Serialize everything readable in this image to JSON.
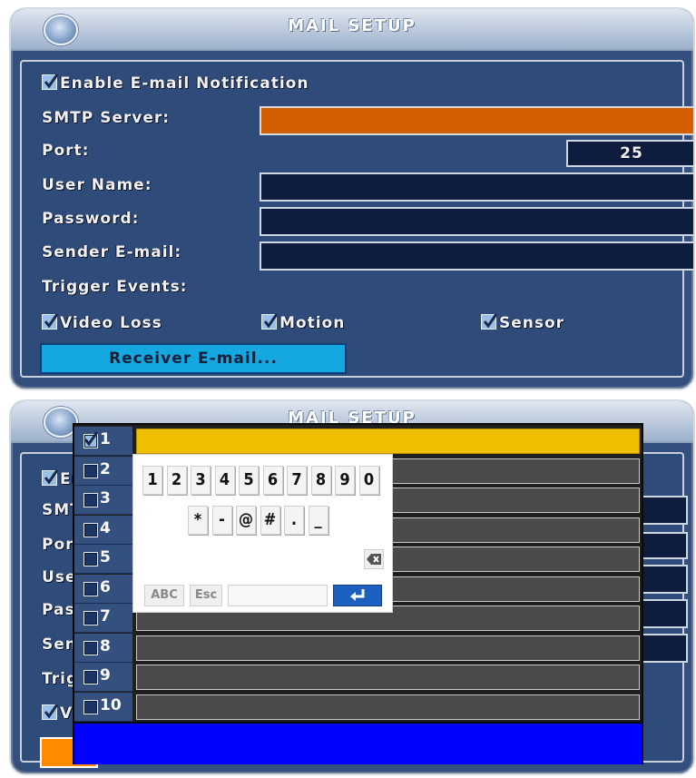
{
  "top": {
    "title": "MAIL SETUP",
    "enable_label": "Enable E-mail Notification",
    "enable_checked": true,
    "smtp_label": "SMTP Server:",
    "smtp_value": "",
    "port_label": "Port:",
    "port_value": "25",
    "user_label": "User Name:",
    "user_value": "",
    "password_label": "Password:",
    "password_value": "",
    "sender_label": "Sender E-mail:",
    "sender_value": "",
    "trigger_label": "Trigger Events:",
    "triggers": [
      {
        "label": "Video Loss",
        "checked": true
      },
      {
        "label": "Motion",
        "checked": true
      },
      {
        "label": "Sensor",
        "checked": true
      }
    ],
    "receiver_button": "Receiver E-mail..."
  },
  "bottom": {
    "title": "MAIL SETUP",
    "partial_labels": [
      "En",
      "SMT",
      "Port",
      "User",
      "Pass",
      "Senc",
      "Trig",
      "Vi"
    ],
    "receivers": [
      {
        "num": "1",
        "checked": true,
        "value": ""
      },
      {
        "num": "2",
        "checked": false,
        "value": ""
      },
      {
        "num": "3",
        "checked": false,
        "value": ""
      },
      {
        "num": "4",
        "checked": false,
        "value": ""
      },
      {
        "num": "5",
        "checked": false,
        "value": ""
      },
      {
        "num": "6",
        "checked": false,
        "value": ""
      },
      {
        "num": "7",
        "checked": false,
        "value": ""
      },
      {
        "num": "8",
        "checked": false,
        "value": ""
      },
      {
        "num": "9",
        "checked": false,
        "value": ""
      },
      {
        "num": "10",
        "checked": false,
        "value": ""
      }
    ],
    "keypad": {
      "digits": [
        "1",
        "2",
        "3",
        "4",
        "5",
        "6",
        "7",
        "8",
        "9",
        "0"
      ],
      "symbols": [
        "*",
        "-",
        "@",
        "#",
        ".",
        "_"
      ],
      "abc": "ABC",
      "esc": "Esc",
      "input_value": "",
      "backspace_icon": "backspace-icon",
      "enter_icon": "enter-icon"
    }
  },
  "colors": {
    "panel": "#34507f",
    "field": "#0e1c3d",
    "smtp_highlight": "#d35f04",
    "receiver_button": "#15a7e0",
    "selected_row": "#f0bf00",
    "footer_blue": "#0000ff"
  }
}
